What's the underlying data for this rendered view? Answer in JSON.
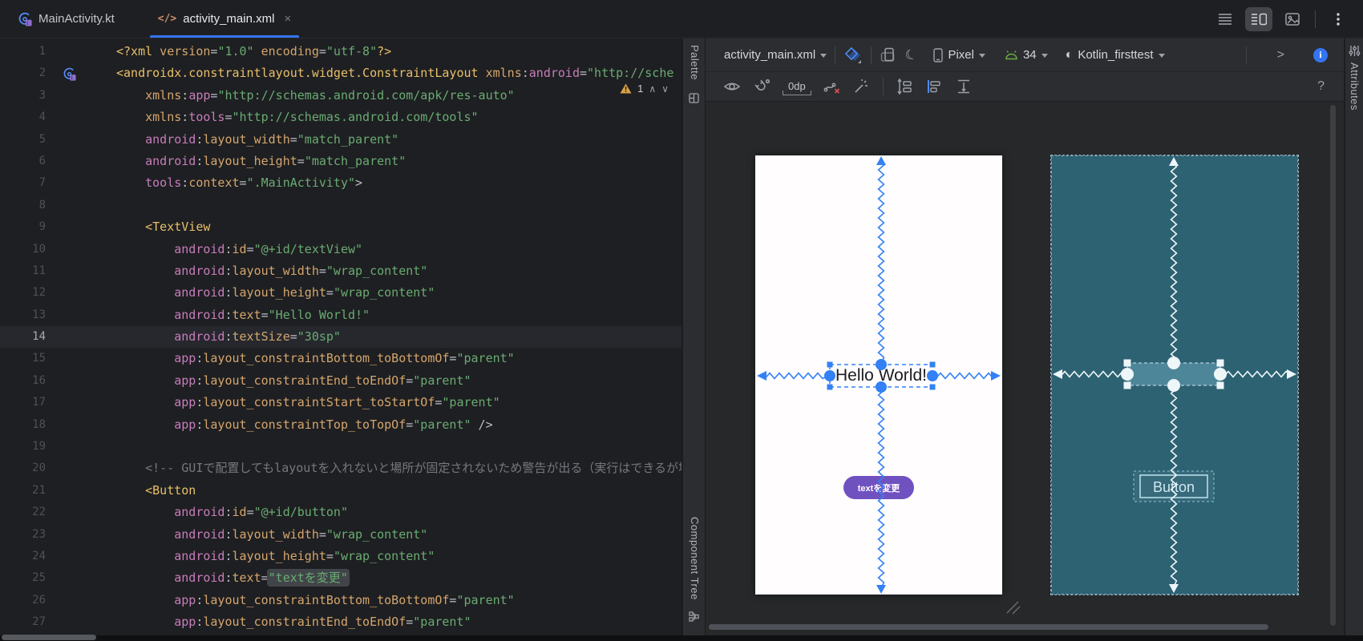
{
  "window": {
    "tabs": [
      {
        "label": "MainActivity.kt",
        "icon": "kotlin-activity-icon"
      },
      {
        "label": "activity_main.xml",
        "icon": "xml-code-icon",
        "icon_glyph": "</>",
        "close": "×",
        "active": true
      }
    ],
    "view_modes": {
      "code": "code-view",
      "split": "split-view",
      "design": "design-view",
      "more": "⋮"
    }
  },
  "editor": {
    "warning_count": "1",
    "warning_prev": "∧",
    "warning_next": "∨",
    "lines": [
      {
        "n": "1",
        "s": [
          [
            "t",
            "<?xml"
          ],
          [
            "a",
            " version"
          ],
          [
            "w",
            "="
          ],
          [
            "s",
            "\"1.0\""
          ],
          [
            "a",
            " encoding"
          ],
          [
            "w",
            "="
          ],
          [
            "s",
            "\"utf-8\""
          ],
          [
            "t",
            "?>"
          ]
        ]
      },
      {
        "n": "2",
        "icon": true,
        "s": [
          [
            "t",
            "<androidx.constraintlayout.widget.ConstraintLayout"
          ],
          [
            "a",
            " xmlns"
          ],
          [
            "w",
            ":"
          ],
          [
            "p",
            "android"
          ],
          [
            "w",
            "="
          ],
          [
            "s",
            "\"http://sche"
          ]
        ]
      },
      {
        "n": "3",
        "s": [
          [
            "a",
            "    xmlns"
          ],
          [
            "w",
            ":"
          ],
          [
            "p",
            "app"
          ],
          [
            "w",
            "="
          ],
          [
            "s",
            "\"http://schemas.android.com/apk/res-auto\""
          ]
        ]
      },
      {
        "n": "4",
        "s": [
          [
            "a",
            "    xmlns"
          ],
          [
            "w",
            ":"
          ],
          [
            "p",
            "tools"
          ],
          [
            "w",
            "="
          ],
          [
            "s",
            "\"http://schemas.android.com/tools\""
          ]
        ]
      },
      {
        "n": "5",
        "s": [
          [
            "p",
            "    android"
          ],
          [
            "w",
            ":"
          ],
          [
            "a",
            "layout_width"
          ],
          [
            "w",
            "="
          ],
          [
            "s",
            "\"match_parent\""
          ]
        ]
      },
      {
        "n": "6",
        "s": [
          [
            "p",
            "    android"
          ],
          [
            "w",
            ":"
          ],
          [
            "a",
            "layout_height"
          ],
          [
            "w",
            "="
          ],
          [
            "s",
            "\"match_parent\""
          ]
        ]
      },
      {
        "n": "7",
        "s": [
          [
            "p",
            "    tools"
          ],
          [
            "w",
            ":"
          ],
          [
            "a",
            "context"
          ],
          [
            "w",
            "="
          ],
          [
            "s",
            "\".MainActivity\""
          ],
          [
            "w",
            ">"
          ]
        ]
      },
      {
        "n": "8",
        "s": []
      },
      {
        "n": "9",
        "s": [
          [
            "t",
            "    <TextView"
          ]
        ]
      },
      {
        "n": "10",
        "s": [
          [
            "p",
            "        android"
          ],
          [
            "w",
            ":"
          ],
          [
            "a",
            "id"
          ],
          [
            "w",
            "="
          ],
          [
            "s",
            "\"@+id/textView\""
          ]
        ]
      },
      {
        "n": "11",
        "s": [
          [
            "p",
            "        android"
          ],
          [
            "w",
            ":"
          ],
          [
            "a",
            "layout_width"
          ],
          [
            "w",
            "="
          ],
          [
            "s",
            "\"wrap_content\""
          ]
        ]
      },
      {
        "n": "12",
        "s": [
          [
            "p",
            "        android"
          ],
          [
            "w",
            ":"
          ],
          [
            "a",
            "layout_height"
          ],
          [
            "w",
            "="
          ],
          [
            "s",
            "\"wrap_content\""
          ]
        ]
      },
      {
        "n": "13",
        "s": [
          [
            "p",
            "        android"
          ],
          [
            "w",
            ":"
          ],
          [
            "a",
            "text"
          ],
          [
            "w",
            "="
          ],
          [
            "s",
            "\"Hello World!\""
          ]
        ]
      },
      {
        "n": "14",
        "cur": true,
        "s": [
          [
            "p",
            "        android"
          ],
          [
            "w",
            ":"
          ],
          [
            "a",
            "textSize"
          ],
          [
            "w",
            "="
          ],
          [
            "s",
            "\"30sp\""
          ]
        ]
      },
      {
        "n": "15",
        "s": [
          [
            "p",
            "        app"
          ],
          [
            "w",
            ":"
          ],
          [
            "a",
            "layout_constraintBottom_toBottomOf"
          ],
          [
            "w",
            "="
          ],
          [
            "s",
            "\"parent\""
          ]
        ]
      },
      {
        "n": "16",
        "s": [
          [
            "p",
            "        app"
          ],
          [
            "w",
            ":"
          ],
          [
            "a",
            "layout_constraintEnd_toEndOf"
          ],
          [
            "w",
            "="
          ],
          [
            "s",
            "\"parent\""
          ]
        ]
      },
      {
        "n": "17",
        "s": [
          [
            "p",
            "        app"
          ],
          [
            "w",
            ":"
          ],
          [
            "a",
            "layout_constraintStart_toStartOf"
          ],
          [
            "w",
            "="
          ],
          [
            "s",
            "\"parent\""
          ]
        ]
      },
      {
        "n": "18",
        "s": [
          [
            "p",
            "        app"
          ],
          [
            "w",
            ":"
          ],
          [
            "a",
            "layout_constraintTop_toTopOf"
          ],
          [
            "w",
            "="
          ],
          [
            "s",
            "\"parent\""
          ],
          [
            "w",
            " />"
          ]
        ]
      },
      {
        "n": "19",
        "s": []
      },
      {
        "n": "20",
        "s": [
          [
            "c",
            "    <!-- GUIで配置してもlayoutを入れないと場所が固定されないため警告が出る（実行はできるが場"
          ]
        ]
      },
      {
        "n": "21",
        "s": [
          [
            "t",
            "    <Button"
          ]
        ]
      },
      {
        "n": "22",
        "s": [
          [
            "p",
            "        android"
          ],
          [
            "w",
            ":"
          ],
          [
            "a",
            "id"
          ],
          [
            "w",
            "="
          ],
          [
            "s",
            "\"@+id/button\""
          ]
        ]
      },
      {
        "n": "23",
        "s": [
          [
            "p",
            "        android"
          ],
          [
            "w",
            ":"
          ],
          [
            "a",
            "layout_width"
          ],
          [
            "w",
            "="
          ],
          [
            "s",
            "\"wrap_content\""
          ]
        ]
      },
      {
        "n": "24",
        "s": [
          [
            "p",
            "        android"
          ],
          [
            "w",
            ":"
          ],
          [
            "a",
            "layout_height"
          ],
          [
            "w",
            "="
          ],
          [
            "s",
            "\"wrap_content\""
          ]
        ]
      },
      {
        "n": "25",
        "s": [
          [
            "p",
            "        android"
          ],
          [
            "w",
            ":"
          ],
          [
            "a",
            "text"
          ],
          [
            "w",
            "="
          ],
          [
            "ss",
            "\"textを変更\""
          ]
        ]
      },
      {
        "n": "26",
        "s": [
          [
            "p",
            "        app"
          ],
          [
            "w",
            ":"
          ],
          [
            "a",
            "layout_constraintBottom_toBottomOf"
          ],
          [
            "w",
            "="
          ],
          [
            "s",
            "\"parent\""
          ]
        ]
      },
      {
        "n": "27",
        "s": [
          [
            "p",
            "        app"
          ],
          [
            "w",
            ":"
          ],
          [
            "a",
            "layout_constraintEnd_toEndOf"
          ],
          [
            "w",
            "="
          ],
          [
            "s",
            "\"parent\""
          ]
        ]
      }
    ]
  },
  "strips": {
    "palette": "Palette",
    "component_tree": "Component Tree",
    "attributes": "Attributes"
  },
  "design": {
    "toolbar": {
      "file": "activity_main.xml",
      "device": "Pixel",
      "api": "34",
      "theme": "Kotlin_firsttest",
      "margin": "0dp",
      "nav_arrow": ">",
      "help": "?"
    },
    "surface": {
      "hello_text": "Hello World!",
      "purple_button_label": "textを変更",
      "blueprint_button_label": "Button"
    }
  },
  "icons": {
    "design_blueprint_toggle": "blue-diamond",
    "orientation": "rotate-device",
    "night_mode": "☾",
    "device": "phone",
    "api_level": "android-head",
    "theme": "◐",
    "view_options": "eye",
    "autoconnect": "magnet",
    "clear_constraints": "chain-with-red-x",
    "infer_constraints": "magic-wand",
    "pack": "pack-arrows",
    "align": "align-bars",
    "guidelines": "distribute-beam",
    "attributes_panel": "sliders",
    "warning": "⚠"
  },
  "colors": {
    "accent_blue": "#3574f0",
    "selection_blue": "#3381f5",
    "blueprint_bg": "#2d6273",
    "blueprint_fill": "#4e8699",
    "button_purple": "#7051c0",
    "string_green": "#6aab73",
    "tag_tan": "#e8bf6a",
    "prefix_magenta": "#c77dbb",
    "warning_yellow": "#d9a343",
    "android_green": "#6cad3f"
  }
}
